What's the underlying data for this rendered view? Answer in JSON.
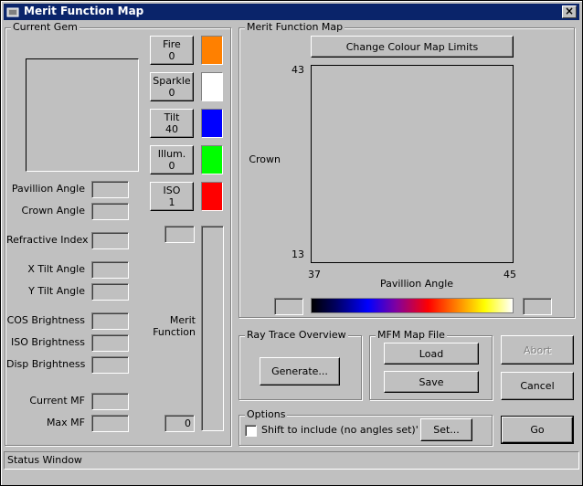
{
  "window": {
    "title": "Merit Function Map",
    "close_glyph": "×"
  },
  "current_gem": {
    "label": "Current Gem",
    "metrics": [
      {
        "label": "Fire",
        "value": "0",
        "color": "#ff8000"
      },
      {
        "label": "Sparkle",
        "value": "0",
        "color": "#ffffff"
      },
      {
        "label": "Tilt",
        "value": "40",
        "color": "#0000ff"
      },
      {
        "label": "Illum.",
        "value": "0",
        "color": "#00ff00"
      },
      {
        "label": "ISO",
        "value": "1",
        "color": "#ff0000"
      }
    ],
    "fields": [
      "Pavillion Angle",
      "Crown Angle",
      "Refractive Index",
      "X Tilt Angle",
      "Y Tilt Angle",
      "COS Brightness",
      "ISO Brightness",
      "Disp Brightness",
      "Current MF",
      "Max MF"
    ],
    "merit_label_1": "Merit",
    "merit_label_2": "Function",
    "merit_value": "0"
  },
  "map": {
    "label": "Merit Function Map",
    "change_button": "Change Colour Map Limits",
    "y_label": "Crown",
    "x_label": "Pavillion Angle",
    "y_max": "43",
    "y_min": "13",
    "x_min": "37",
    "x_max": "45"
  },
  "ray_trace": {
    "label": "Ray Trace Overview",
    "generate_button": "Generate..."
  },
  "mfm_file": {
    "label": "MFM Map File",
    "load_button": "Load",
    "save_button": "Save"
  },
  "buttons": {
    "abort": "Abort",
    "cancel": "Cancel",
    "go": "Go"
  },
  "options": {
    "label": "Options",
    "checkbox_label": "Shift to include (no angles set)'",
    "checkbox_checked": false,
    "set_button": "Set..."
  },
  "status": {
    "text": "Status Window"
  }
}
